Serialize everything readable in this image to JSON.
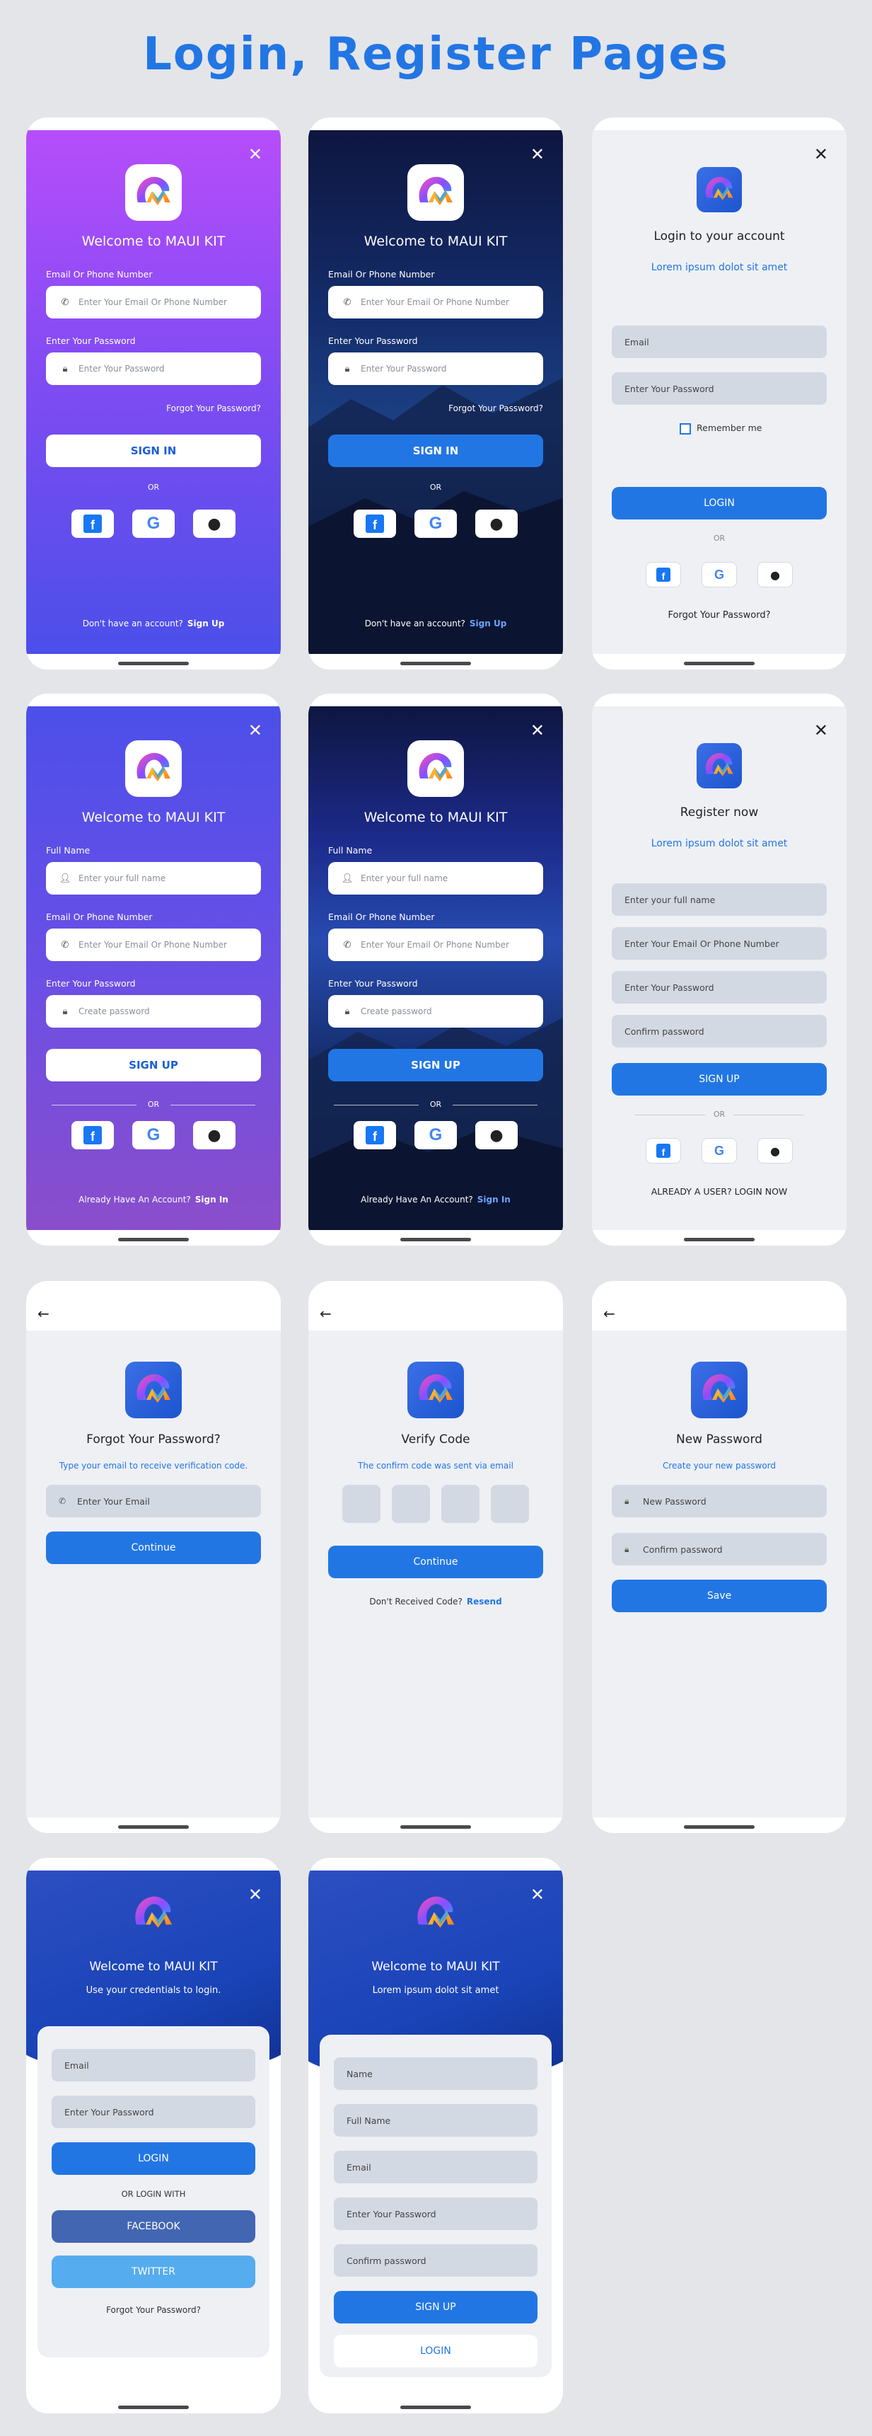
{
  "page": {
    "title": "Login, Register Pages"
  },
  "colors": {
    "accent": "#2276e4",
    "purple_top": "#b64dfb",
    "purple_bottom": "#4b4fe9",
    "navy": "#0f1746",
    "light_bg": "#eef0f4"
  },
  "login_purple": {
    "welcome": "Welcome to MAUI KIT",
    "email_label": "Email Or Phone Number",
    "email_placeholder": "Enter Your Email Or Phone Number",
    "password_label": "Enter Your Password",
    "password_placeholder": "Enter Your Password",
    "forgot": "Forgot Your Password?",
    "signin": "SIGN IN",
    "or": "OR",
    "no_account": "Don't have an account?",
    "signup": "Sign Up"
  },
  "login_dark": {
    "welcome": "Welcome to MAUI KIT",
    "email_label": "Email Or Phone Number",
    "email_placeholder": "Enter Your Email Or Phone Number",
    "password_label": "Enter Your Password",
    "password_placeholder": "Enter Your Password",
    "forgot": "Forgot Your Password?",
    "signin": "SIGN IN",
    "or": "OR",
    "no_account": "Don't have an account?",
    "signup": "Sign Up"
  },
  "login_light": {
    "title": "Login to your account",
    "subtitle": "Lorem ipsum dolot sit amet",
    "email_placeholder": "Email",
    "password_placeholder": "Enter Your Password",
    "remember": "Remember me",
    "login": "LOGIN",
    "or": "OR",
    "forgot": "Forgot Your Password?"
  },
  "register_purple": {
    "welcome": "Welcome to MAUI KIT",
    "name_label": "Full Name",
    "name_placeholder": "Enter your full name",
    "email_label": "Email Or Phone Number",
    "email_placeholder": "Enter Your Email Or Phone Number",
    "password_label": "Enter Your Password",
    "password_placeholder": "Create password",
    "signup": "SIGN UP",
    "or": "OR",
    "have_account": "Already Have An Account?",
    "signin": "Sign In"
  },
  "register_dark": {
    "welcome": "Welcome to MAUI KIT",
    "name_label": "Full Name",
    "name_placeholder": "Enter your full name",
    "email_label": "Email Or Phone Number",
    "email_placeholder": "Enter Your Email Or Phone Number",
    "password_label": "Enter Your Password",
    "password_placeholder": "Create password",
    "signup": "SIGN UP",
    "or": "OR",
    "have_account": "Already Have An Account?",
    "signin": "Sign In"
  },
  "register_light": {
    "title": "Register now",
    "subtitle": "Lorem ipsum dolot sit amet",
    "name_placeholder": "Enter your full name",
    "email_placeholder": "Enter Your Email Or Phone Number",
    "password_placeholder": "Enter Your Password",
    "confirm_placeholder": "Confirm password",
    "signup": "SIGN UP",
    "or": "OR",
    "login_link": "ALREADY A USER? LOGIN NOW"
  },
  "forgot": {
    "title": "Forgot Your Password?",
    "subtitle": "Type your email to receive verification code.",
    "email_placeholder": "Enter Your Email",
    "continue": "Continue"
  },
  "verify": {
    "title": "Verify Code",
    "subtitle": "The confirm code was sent via email",
    "continue": "Continue",
    "not_received": "Don't Received Code?",
    "resend": "Resend"
  },
  "new_password": {
    "title": "New Password",
    "subtitle": "Create your new password",
    "new_placeholder": "New Password",
    "confirm_placeholder": "Confirm password",
    "save": "Save"
  },
  "login_card": {
    "welcome": "Welcome to MAUI KIT",
    "subtitle": "Use your credentials to login.",
    "email_placeholder": "Email",
    "password_placeholder": "Enter Your Password",
    "login": "LOGIN",
    "or_login_with": "OR LOGIN WITH",
    "facebook": "FACEBOOK",
    "twitter": "TWITTER",
    "forgot": "Forgot Your Password?"
  },
  "register_card": {
    "welcome": "Welcome to MAUI KIT",
    "subtitle": "Lorem ipsum dolot sit amet",
    "name_placeholder": "Name",
    "fullname_placeholder": "Full Name",
    "email_placeholder": "Email",
    "password_placeholder": "Enter Your Password",
    "confirm_placeholder": "Confirm password",
    "signup": "SIGN UP",
    "login": "LOGIN"
  }
}
